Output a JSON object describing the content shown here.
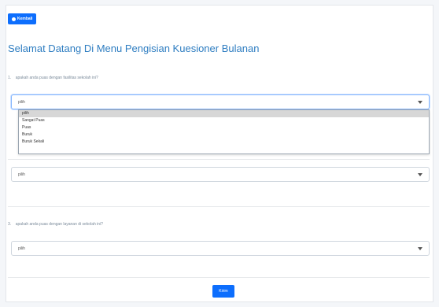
{
  "header": {
    "back_label": "Kembali",
    "title": "Selamat Datang Di Menu Pengisian Kuesioner Bulanan"
  },
  "questions": [
    {
      "number": "1.",
      "text": "apakah anda puas dengan fasilitas sekolah ini?",
      "selected": "pilih"
    },
    {
      "number": "2.",
      "text": "",
      "selected": "pilih"
    },
    {
      "number": "3.",
      "text": "apakah anda puas dengan layanan di sekolah ini?",
      "selected": "pilih"
    }
  ],
  "dropdown_options": [
    "pilih",
    "Sangat Puas",
    "Puas",
    "Buruk",
    "Buruk Sekali"
  ],
  "footer": {
    "submit_label": "Kirim"
  }
}
